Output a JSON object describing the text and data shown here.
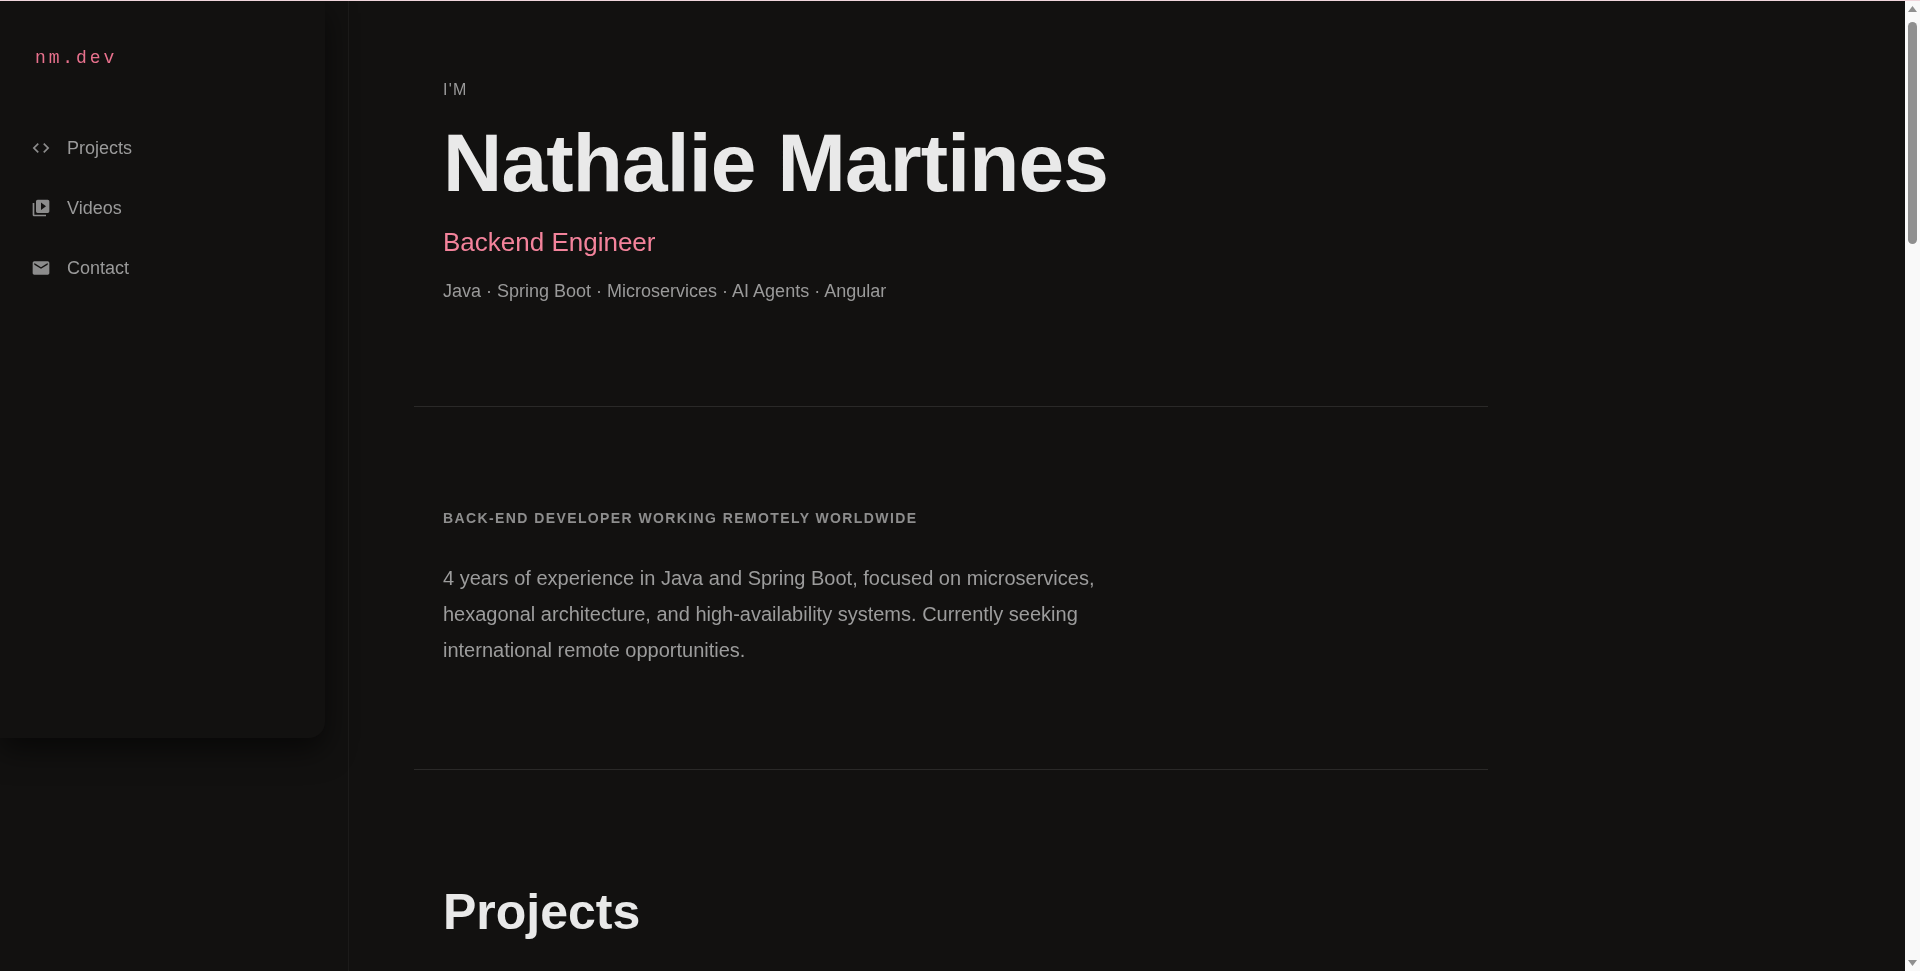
{
  "sidebar": {
    "logo": "nm.dev",
    "nav": [
      {
        "label": "Projects"
      },
      {
        "label": "Videos"
      },
      {
        "label": "Contact"
      }
    ]
  },
  "hero": {
    "eyebrow": "I'M",
    "name": "Nathalie Martines",
    "role": "Backend Engineer",
    "skills": "Java · Spring Boot · Microservices · AI Agents · Angular"
  },
  "about": {
    "heading": "BACK-END DEVELOPER WORKING REMOTELY WORLDWIDE",
    "text": "4 years of experience in Java and Spring Boot, focused on microservices, hexagonal architecture, and high-availability systems. Currently seeking international remote opportunities."
  },
  "projects": {
    "heading": "Projects"
  }
}
